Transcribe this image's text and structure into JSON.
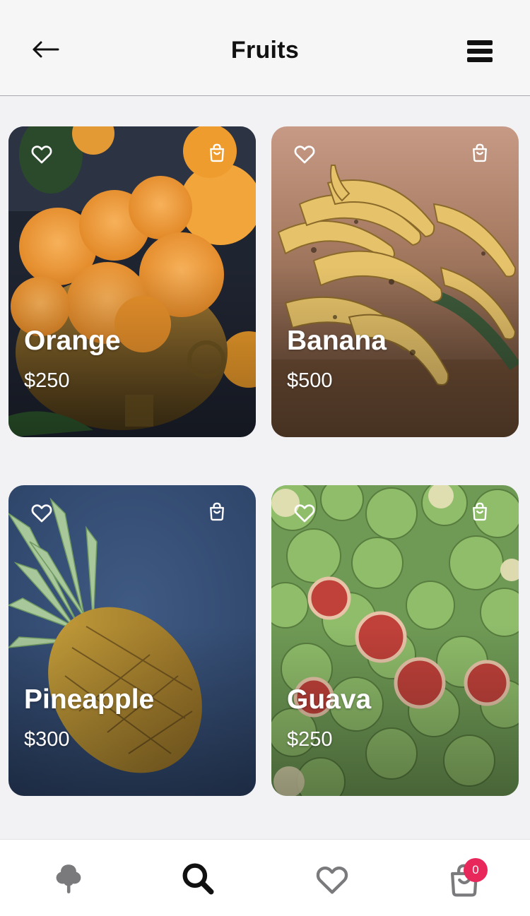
{
  "header": {
    "title": "Fruits",
    "back_icon": "arrow-left-icon",
    "menu_icon": "hamburger-menu-icon"
  },
  "products": [
    {
      "name": "Orange",
      "price": "$250"
    },
    {
      "name": "Banana",
      "price": "$500"
    },
    {
      "name": "Pineapple",
      "price": "$300"
    },
    {
      "name": "Guava",
      "price": "$250"
    }
  ],
  "card_icons": {
    "favorite": "heart-outline-icon",
    "cart": "shopping-bag-icon"
  },
  "tabbar": {
    "items": [
      {
        "icon": "tree-icon",
        "active": false
      },
      {
        "icon": "search-icon",
        "active": true
      },
      {
        "icon": "heart-icon",
        "active": false
      },
      {
        "icon": "cart-bag-icon",
        "active": false
      }
    ],
    "cart_count": "0"
  },
  "colors": {
    "background": "#f2f2f4",
    "badge": "#e8275a",
    "active_icon": "#111111",
    "inactive_icon": "#7a7a7d"
  }
}
